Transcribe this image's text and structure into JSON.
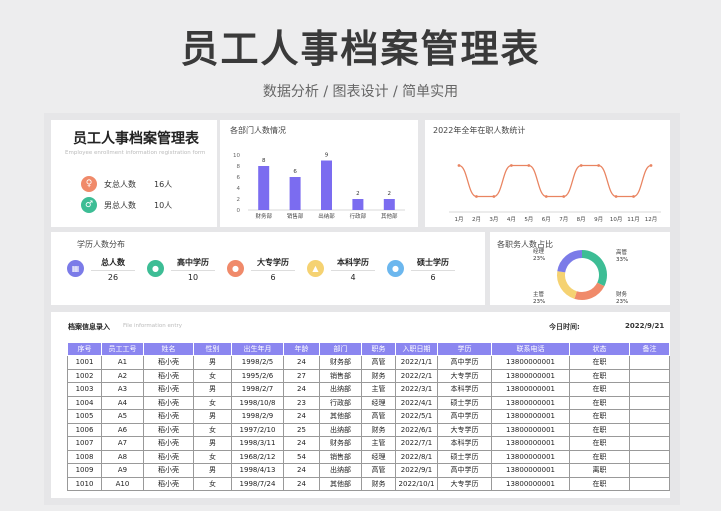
{
  "poster": {
    "title": "员工人事档案管理表",
    "subtitle": "数据分析 / 图表设计 / 简单实用"
  },
  "summary": {
    "title": "员工人事档案管理表",
    "subtitle": "Employee enrollment information registration form",
    "female_label": "女总人数",
    "female_value": "16人",
    "male_label": "男总人数",
    "male_value": "10人"
  },
  "dept_chart": {
    "title": "各部门人数情况",
    "chart_data": {
      "type": "bar",
      "categories": [
        "财务部",
        "销售部",
        "出纳部",
        "行政部",
        "其他部"
      ],
      "values": [
        8,
        6,
        9,
        2,
        2
      ],
      "ylim": [
        0,
        10
      ],
      "yticks": [
        0,
        2,
        4,
        6,
        8,
        10
      ],
      "color": "#7b6cf0"
    }
  },
  "year_chart": {
    "title": "2022年全年在职人数统计",
    "chart_data": {
      "type": "line",
      "x": [
        "1月",
        "2月",
        "3月",
        "4月",
        "5月",
        "6月",
        "7月",
        "8月",
        "9月",
        "10月",
        "11月",
        "12月"
      ],
      "values": [
        9,
        3,
        3,
        9,
        9,
        3,
        3,
        9,
        9,
        3,
        3,
        9
      ],
      "ylim": [
        0,
        12
      ],
      "color": "#e98461"
    }
  },
  "education": {
    "title": "学历人数分布",
    "items": [
      {
        "label": "总人数",
        "value": "26",
        "color": "#7b7be8",
        "icon": "grid-icon"
      },
      {
        "label": "高中学历",
        "value": "10",
        "color": "#3dbd95",
        "icon": "person-icon"
      },
      {
        "label": "大专学历",
        "value": "6",
        "color": "#f08a6a",
        "icon": "person-icon"
      },
      {
        "label": "本科学历",
        "value": "4",
        "color": "#f5d272",
        "icon": "grad-cap-icon"
      },
      {
        "label": "硕士学历",
        "value": "6",
        "color": "#6cb7ee",
        "icon": "person-icon"
      }
    ]
  },
  "position_chart": {
    "title": "各职务人数占比",
    "chart_data": {
      "type": "pie",
      "categories": [
        "高管",
        "财务",
        "主管",
        "经理"
      ],
      "values": [
        33,
        23,
        23,
        23
      ],
      "labels": [
        "33%",
        "23%",
        "23%",
        "23%"
      ],
      "colors": [
        "#3dbd95",
        "#f08a6a",
        "#f5d272",
        "#7b7be8"
      ]
    }
  },
  "file": {
    "title": "档案信息录入",
    "subtitle": "File information entry",
    "date_label": "今日时间:",
    "date_value": "2022/9/21",
    "headers": [
      "序号",
      "员工工号",
      "姓名",
      "性别",
      "出生年月",
      "年龄",
      "部门",
      "职务",
      "入职日期",
      "学历",
      "联系电话",
      "状态",
      "备注"
    ],
    "rows": [
      [
        "1001",
        "A1",
        "稻小壳",
        "男",
        "1998/2/5",
        "24",
        "财务部",
        "高管",
        "2022/1/1",
        "高中学历",
        "13800000001",
        "在职",
        ""
      ],
      [
        "1002",
        "A2",
        "稻小壳",
        "女",
        "1995/2/6",
        "27",
        "销售部",
        "财务",
        "2022/2/1",
        "大专学历",
        "13800000001",
        "在职",
        ""
      ],
      [
        "1003",
        "A3",
        "稻小壳",
        "男",
        "1998/2/7",
        "24",
        "出纳部",
        "主管",
        "2022/3/1",
        "本科学历",
        "13800000001",
        "在职",
        ""
      ],
      [
        "1004",
        "A4",
        "稻小壳",
        "女",
        "1998/10/8",
        "23",
        "行政部",
        "经理",
        "2022/4/1",
        "硕士学历",
        "13800000001",
        "在职",
        ""
      ],
      [
        "1005",
        "A5",
        "稻小壳",
        "男",
        "1998/2/9",
        "24",
        "其他部",
        "高管",
        "2022/5/1",
        "高中学历",
        "13800000001",
        "在职",
        ""
      ],
      [
        "1006",
        "A6",
        "稻小壳",
        "女",
        "1997/2/10",
        "25",
        "出纳部",
        "财务",
        "2022/6/1",
        "大专学历",
        "13800000001",
        "在职",
        ""
      ],
      [
        "1007",
        "A7",
        "稻小壳",
        "男",
        "1998/3/11",
        "24",
        "财务部",
        "主管",
        "2022/7/1",
        "本科学历",
        "13800000001",
        "在职",
        ""
      ],
      [
        "1008",
        "A8",
        "稻小壳",
        "女",
        "1968/2/12",
        "54",
        "销售部",
        "经理",
        "2022/8/1",
        "硕士学历",
        "13800000001",
        "在职",
        ""
      ],
      [
        "1009",
        "A9",
        "稻小壳",
        "男",
        "1998/4/13",
        "24",
        "出纳部",
        "高管",
        "2022/9/1",
        "高中学历",
        "13800000001",
        "离职",
        ""
      ],
      [
        "1010",
        "A10",
        "稻小壳",
        "女",
        "1998/7/24",
        "24",
        "其他部",
        "财务",
        "2022/10/1",
        "大专学历",
        "13800000001",
        "在职",
        ""
      ]
    ]
  }
}
